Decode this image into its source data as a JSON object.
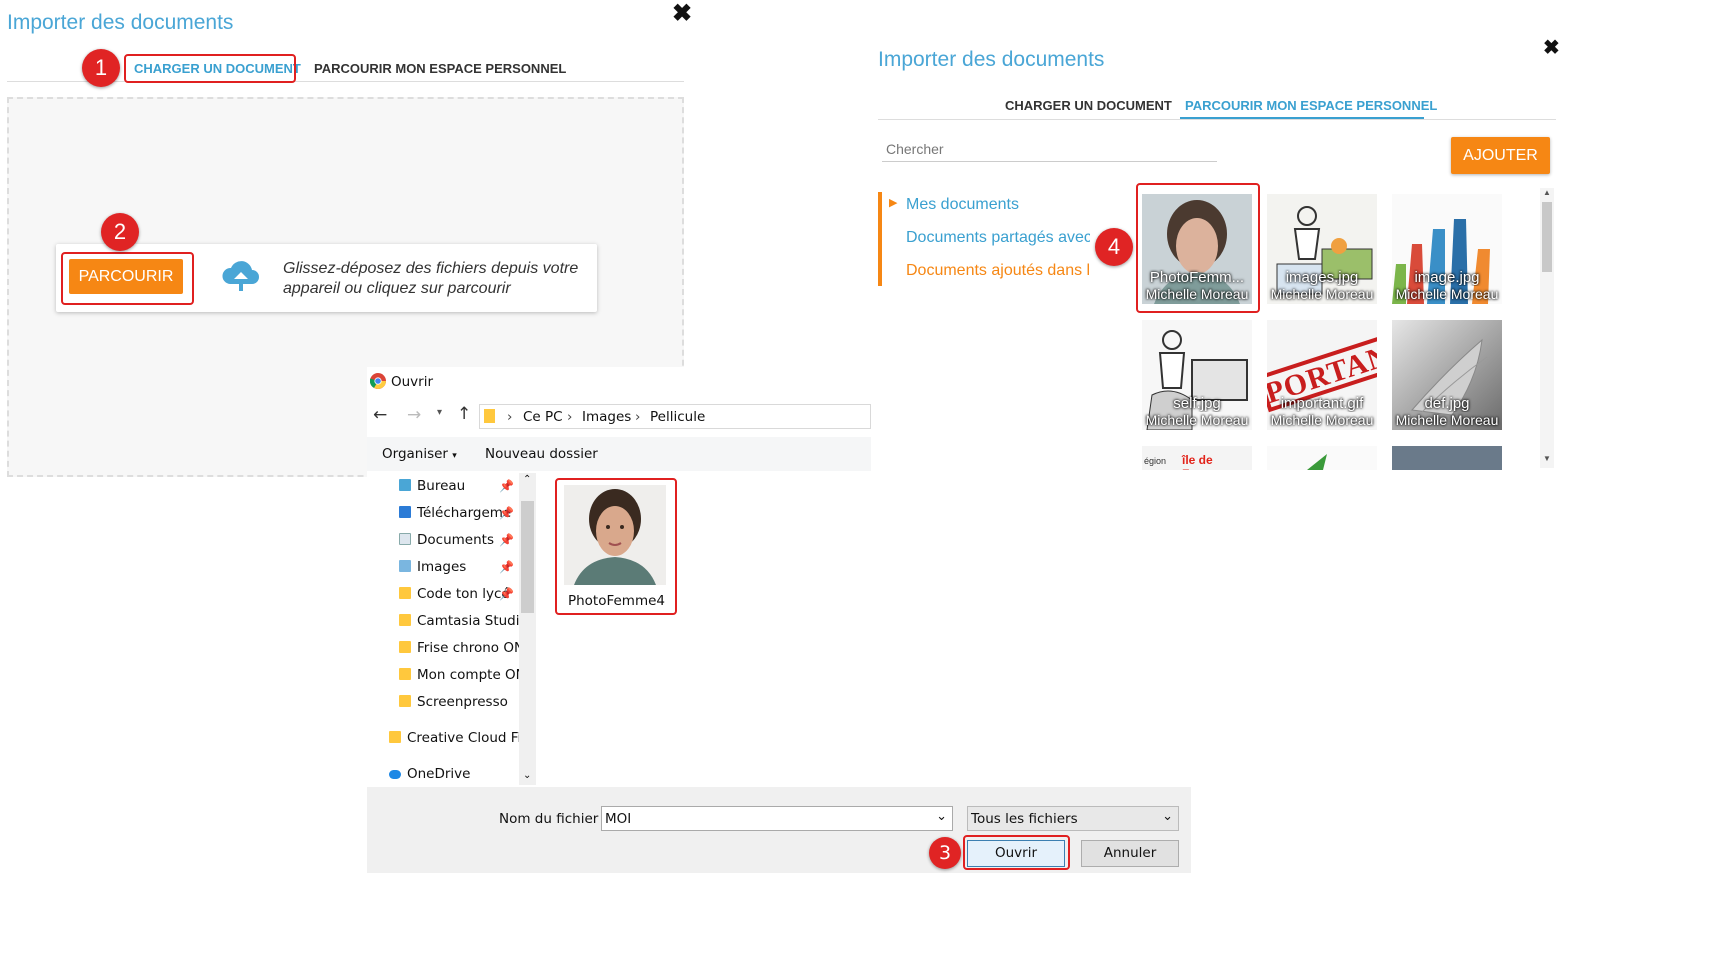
{
  "left_dialog": {
    "title": "Importer des documents",
    "close_icon": "✖",
    "tabs": [
      "CHARGER UN DOCUMENT",
      "PARCOURIR MON ESPACE PERSONNEL"
    ],
    "browse_button": "PARCOURIR",
    "hint": "Glissez-déposez des fichiers depuis votre appareil ou cliquez sur parcourir"
  },
  "right_dialog": {
    "title": "Importer des documents",
    "close_icon": "✖",
    "tabs": [
      "CHARGER UN DOCUMENT",
      "PARCOURIR MON ESPACE PERSONNEL"
    ],
    "search_placeholder": "Chercher",
    "add_button": "AJOUTER",
    "nav": [
      "Mes documents",
      "Documents partagés avec r",
      "Documents ajoutés dans les"
    ],
    "thumbnails": [
      {
        "name": "PhotoFemm...",
        "owner": "Michelle Moreau"
      },
      {
        "name": "images.jpg",
        "owner": "Michelle Moreau"
      },
      {
        "name": "image.jpg",
        "owner": "Michelle Moreau"
      },
      {
        "name": "self.jpg",
        "owner": "Michelle Moreau"
      },
      {
        "name": "important.gif",
        "owner": "Michelle Moreau"
      },
      {
        "name": "def.jpg",
        "owner": "Michelle Moreau"
      }
    ],
    "partial_thumb_text": "île de France",
    "partial_thumb_prefix": "égion",
    "stamp_text": "PORTAN"
  },
  "open_dialog": {
    "title": "Ouvrir",
    "path": [
      "Ce PC",
      "Images",
      "Pellicule"
    ],
    "organize": "Organiser",
    "new_folder": "Nouveau dossier",
    "tree": [
      {
        "label": "Bureau",
        "pinned": true
      },
      {
        "label": "Téléchargeme",
        "pinned": true
      },
      {
        "label": "Documents",
        "pinned": true
      },
      {
        "label": "Images",
        "pinned": true
      },
      {
        "label": "Code ton lycé",
        "pinned": true
      },
      {
        "label": "Camtasia Studio",
        "pinned": false
      },
      {
        "label": "Frise chrono ON",
        "pinned": false
      },
      {
        "label": "Mon compte ON",
        "pinned": false
      },
      {
        "label": "Screenpresso",
        "pinned": false
      },
      {
        "label": "Creative Cloud File",
        "pinned": false
      },
      {
        "label": "OneDrive",
        "pinned": false
      }
    ],
    "file": {
      "name": "PhotoFemme4"
    },
    "filename_label": "Nom du fichier :",
    "filename_value": "MOI",
    "filter_value": "Tous les fichiers",
    "open_button": "Ouvrir",
    "cancel_button": "Annuler"
  },
  "badges": [
    "1",
    "2",
    "3",
    "4"
  ],
  "colors": {
    "accent_blue": "#4aa6d6",
    "orange": "#f68714",
    "red": "#e02424"
  }
}
